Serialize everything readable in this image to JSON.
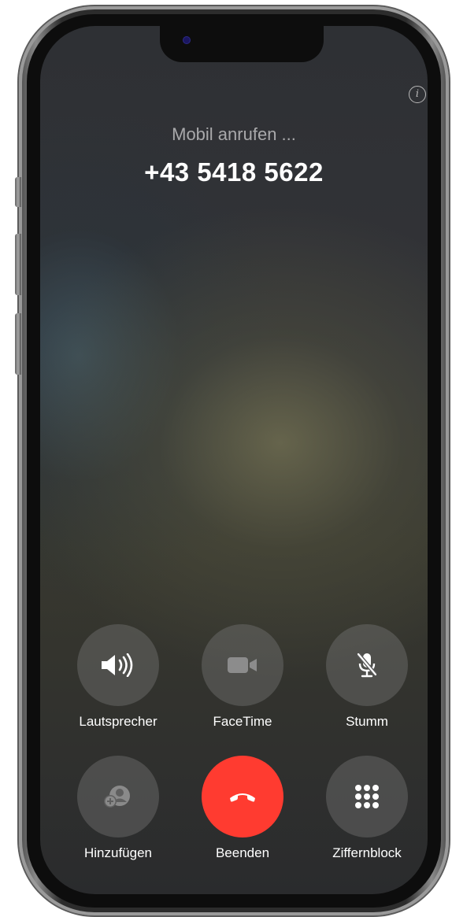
{
  "call": {
    "status": "Mobil anrufen ...",
    "number": "+43 5418 5622"
  },
  "controls": {
    "speaker": {
      "label": "Lautsprecher",
      "icon": "speaker-icon"
    },
    "facetime": {
      "label": "FaceTime",
      "icon": "video-camera-icon",
      "disabled": true
    },
    "mute": {
      "label": "Stumm",
      "icon": "microphone-slash-icon"
    },
    "add": {
      "label": "Hinzufügen",
      "icon": "add-person-icon",
      "disabled": true
    },
    "end": {
      "label": "Beenden",
      "icon": "hang-up-icon"
    },
    "keypad": {
      "label": "Ziffernblock",
      "icon": "keypad-icon"
    }
  },
  "colors": {
    "end_call": "#ff3b30",
    "button_bg": "#6b6b6b",
    "status_text": "#a9a9ab"
  }
}
